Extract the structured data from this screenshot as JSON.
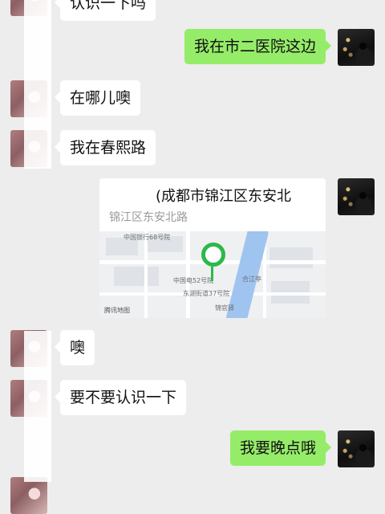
{
  "messages": {
    "m0": "认识一下吗",
    "m1": "我在市二医院这边",
    "m2": "在哪儿噢",
    "m3": "我在春熙路",
    "m5": "噢",
    "m6": "要不要认识一下",
    "m7": "我要晚点哦"
  },
  "location": {
    "title": "(成都市锦江区东安北",
    "address": "锦江区东安北路"
  },
  "map_labels": [
    "中国银行68号院",
    "中国电52号院",
    "东湖街道37号院",
    "锦官驿",
    "合江亭",
    "腾讯地图"
  ],
  "colors": {
    "sent_bubble": "#95ec69",
    "received_bubble": "#ffffff",
    "background": "#ededed",
    "map_pin": "#2eb84b"
  }
}
